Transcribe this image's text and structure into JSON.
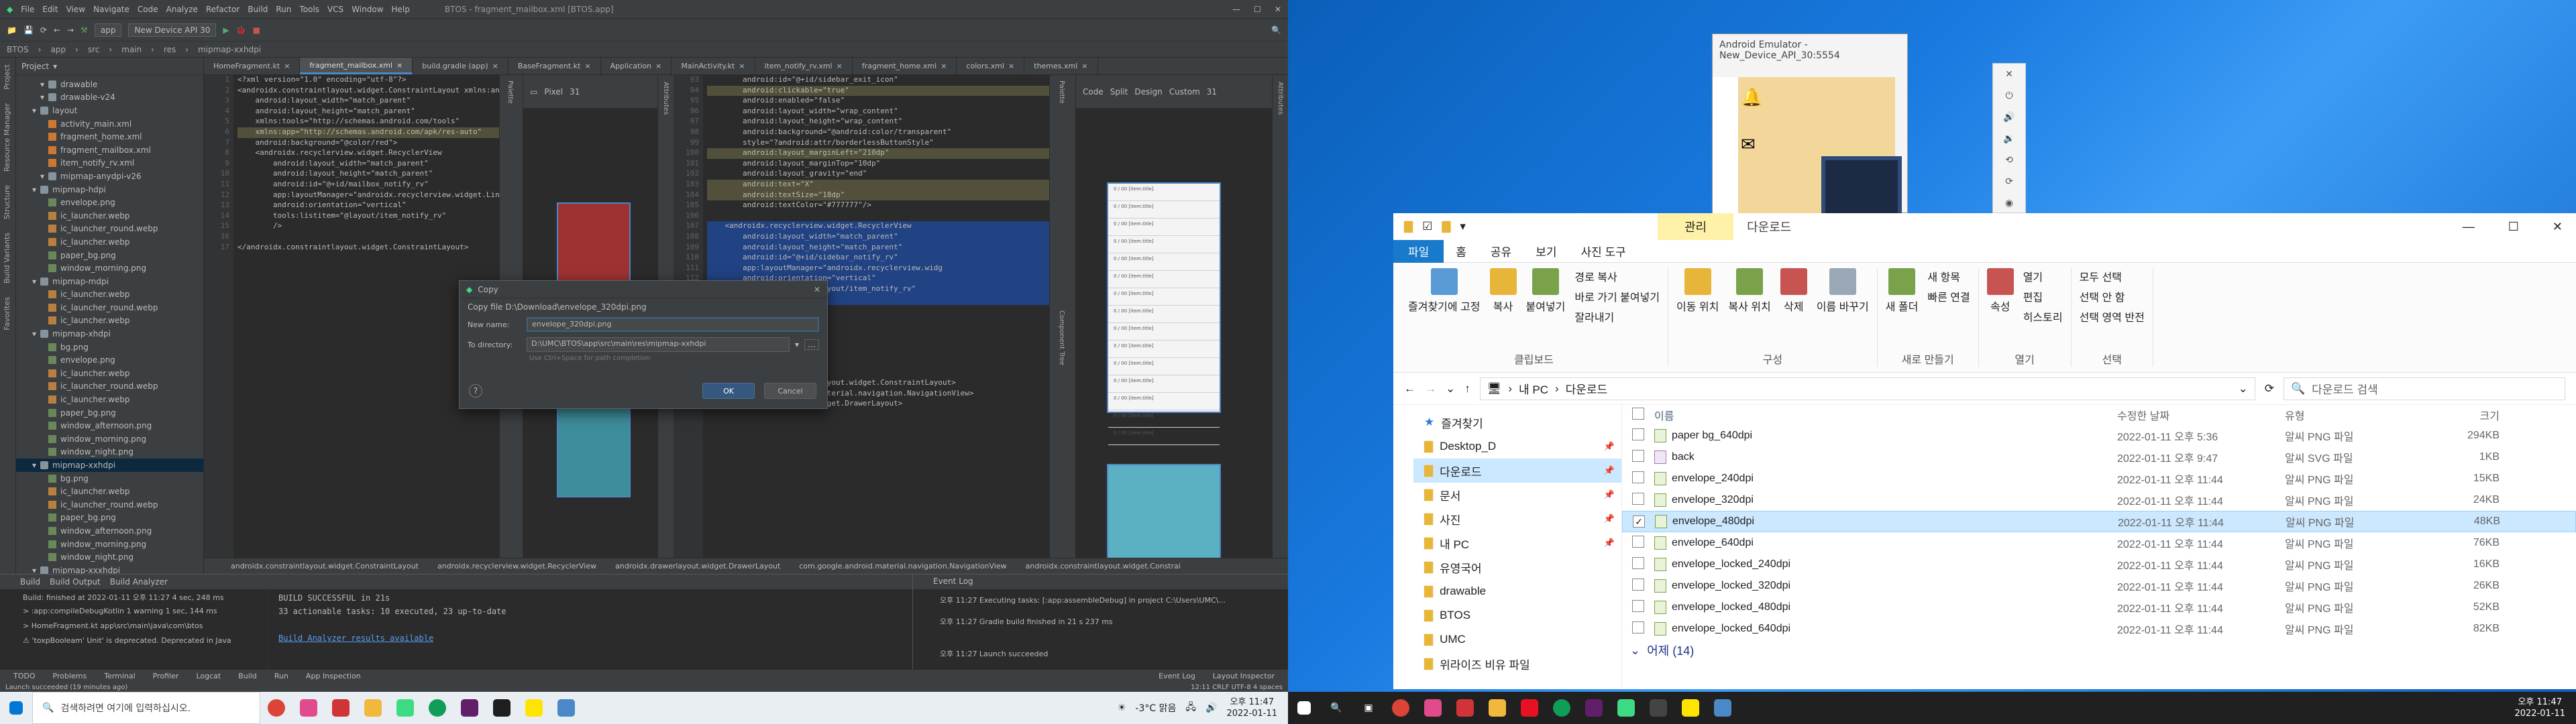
{
  "studio": {
    "menu": [
      "File",
      "Edit",
      "View",
      "Navigate",
      "Code",
      "Analyze",
      "Refactor",
      "Build",
      "Run",
      "Tools",
      "VCS",
      "Window",
      "Help"
    ],
    "window_title": "BTOS - fragment_mailbox.xml [BTOS.app]",
    "toolbar": {
      "module": "app",
      "device": "New Device API 30"
    },
    "breadcrumbs": [
      "BTOS",
      "app",
      "src",
      "main",
      "res",
      "mipmap-xxhdpi"
    ],
    "left_strip": [
      "Project",
      "Resource Manager",
      "Structure",
      "Build Variants",
      "Favorites"
    ],
    "project_header": "Project",
    "tree": [
      {
        "t": "drawable",
        "k": "folder",
        "d": 3
      },
      {
        "t": "drawable-v24",
        "k": "folder",
        "d": 3
      },
      {
        "t": "layout",
        "k": "folder",
        "d": 2
      },
      {
        "t": "activity_main.xml",
        "k": "xml",
        "d": 4
      },
      {
        "t": "fragment_home.xml",
        "k": "xml",
        "d": 4
      },
      {
        "t": "fragment_mailbox.xml",
        "k": "xml",
        "d": 4
      },
      {
        "t": "item_notify_rv.xml",
        "k": "xml",
        "d": 4
      },
      {
        "t": "mipmap-anydpi-v26",
        "k": "folder",
        "d": 3
      },
      {
        "t": "mipmap-hdpi",
        "k": "folder",
        "d": 2
      },
      {
        "t": "envelope.png",
        "k": "png",
        "d": 4
      },
      {
        "t": "ic_launcher.webp",
        "k": "webp",
        "d": 4
      },
      {
        "t": "ic_launcher_round.webp",
        "k": "webp",
        "d": 4
      },
      {
        "t": "ic_launcher.webp",
        "k": "webp",
        "d": 4
      },
      {
        "t": "paper_bg.png",
        "k": "png",
        "d": 4
      },
      {
        "t": "window_morning.png",
        "k": "png",
        "d": 4
      },
      {
        "t": "mipmap-mdpi",
        "k": "folder",
        "d": 2
      },
      {
        "t": "ic_launcher.webp",
        "k": "webp",
        "d": 4
      },
      {
        "t": "ic_launcher_round.webp",
        "k": "webp",
        "d": 4
      },
      {
        "t": "ic_launcher.webp",
        "k": "webp",
        "d": 4
      },
      {
        "t": "mipmap-xhdpi",
        "k": "folder",
        "d": 2
      },
      {
        "t": "bg.png",
        "k": "png",
        "d": 4
      },
      {
        "t": "envelope.png",
        "k": "png",
        "d": 4
      },
      {
        "t": "ic_launcher.webp",
        "k": "webp",
        "d": 4
      },
      {
        "t": "ic_launcher_round.webp",
        "k": "webp",
        "d": 4
      },
      {
        "t": "ic_launcher.webp",
        "k": "webp",
        "d": 4
      },
      {
        "t": "paper_bg.png",
        "k": "png",
        "d": 4
      },
      {
        "t": "window_afternoon.png",
        "k": "png",
        "d": 4
      },
      {
        "t": "window_morning.png",
        "k": "png",
        "d": 4
      },
      {
        "t": "window_night.png",
        "k": "png",
        "d": 4
      },
      {
        "t": "mipmap-xxhdpi",
        "k": "folder",
        "d": 2,
        "sel": true
      },
      {
        "t": "bg.png",
        "k": "png",
        "d": 4
      },
      {
        "t": "ic_launcher.webp",
        "k": "webp",
        "d": 4
      },
      {
        "t": "ic_launcher_round.webp",
        "k": "webp",
        "d": 4
      },
      {
        "t": "paper_bg.png",
        "k": "png",
        "d": 4
      },
      {
        "t": "window_afternoon.png",
        "k": "png",
        "d": 4
      },
      {
        "t": "window_morning.png",
        "k": "png",
        "d": 4
      },
      {
        "t": "window_night.png",
        "k": "png",
        "d": 4
      },
      {
        "t": "mipmap-xxxhdpi",
        "k": "folder",
        "d": 2
      }
    ],
    "tabs": [
      {
        "t": "HomeFragment.kt",
        "a": false
      },
      {
        "t": "fragment_mailbox.xml",
        "a": true
      },
      {
        "t": "build.gradle (app)",
        "a": false
      },
      {
        "t": "BaseFragment.kt",
        "a": false
      },
      {
        "t": "Application",
        "a": false
      },
      {
        "t": "MainActivity.kt",
        "a": false
      },
      {
        "t": "item_notify_rv.xml",
        "a": false
      },
      {
        "t": "fragment_home.xml",
        "a": false
      },
      {
        "t": "colors.xml",
        "a": false
      },
      {
        "t": "themes.xml",
        "a": false
      }
    ],
    "code_left": [
      {
        "t": "<?xml version=\"1.0\" encoding=\"utf-8\"?>"
      },
      {
        "t": "<androidx.constraintlayout.widget.ConstraintLayout xmlns:android=\"http://sch"
      },
      {
        "t": "    android:layout_width=\"match_parent\""
      },
      {
        "t": "    android:layout_height=\"match_parent\""
      },
      {
        "t": "    xmlns:tools=\"http://schemas.android.com/tools\""
      },
      {
        "t": "    xmlns:app=\"http://schemas.android.com/apk/res-auto\"",
        "y": true
      },
      {
        "t": "    android:background=\"@color/red\">"
      },
      {
        "t": "    <androidx.recyclerview.widget.RecyclerView"
      },
      {
        "t": "        android:layout_width=\"match_parent\""
      },
      {
        "t": "        android:layout_height=\"match_parent\""
      },
      {
        "t": "        android:id=\"@+id/mailbox_notify_rv\""
      },
      {
        "t": "        app:layoutManager=\"androidx.recyclerview.widget.LinearLayoutMana"
      },
      {
        "t": "        android:orientation=\"vertical\""
      },
      {
        "t": "        tools:listitem=\"@layout/item_notify_rv\""
      },
      {
        "t": "        />"
      },
      {
        "t": ""
      },
      {
        "t": "</androidx.constraintlayout.widget.ConstraintLayout>"
      }
    ],
    "code_right": [
      {
        "t": "        android:id=\"@+id/sidebar_exit_icon\""
      },
      {
        "t": "        android:clickable=\"true\"",
        "y": true
      },
      {
        "t": "        android:enabled=\"false\""
      },
      {
        "t": "        android:layout_width=\"wrap_content\""
      },
      {
        "t": "        android:layout_height=\"wrap_content\""
      },
      {
        "t": "        android:background=\"@android:color/transparent\""
      },
      {
        "t": "        style=\"?android:attr/borderlessButtonStyle\""
      },
      {
        "t": "        android:layout_marginLeft=\"210dp\"",
        "y": true
      },
      {
        "t": "        android:layout_marginTop=\"10dp\""
      },
      {
        "t": "        android:layout_gravity=\"end\""
      },
      {
        "t": "        android:text=\"X\"",
        "y": true
      },
      {
        "t": "        android:textSize=\"18dp\"",
        "y": true
      },
      {
        "t": "        android:textColor=\"#777777\"/>"
      },
      {
        "t": ""
      },
      {
        "t": "    <androidx.recyclerview.widget.RecyclerView",
        "h": true
      },
      {
        "t": "        android:layout_width=\"match_parent\"",
        "h": true
      },
      {
        "t": "        android:layout_height=\"match_parent\"",
        "h": true
      },
      {
        "t": "        android:id=\"@+id/sidebar_notify_rv\"",
        "h": true
      },
      {
        "t": "        app:layoutManager=\"androidx.recyclerview.widg",
        "h": true
      },
      {
        "t": "        android:orientation=\"vertical\"",
        "h": true
      },
      {
        "t": "        tools:listitem=\"@layout/item_notify_rv\"",
        "h": true
      },
      {
        "t": "        />",
        "h": true
      },
      {
        "t": ""
      },
      {
        "t": ""
      },
      {
        "t": ""
      },
      {
        "t": ""
      },
      {
        "t": ""
      },
      {
        "t": ""
      },
      {
        "t": "        </LinearLayout>"
      },
      {
        "t": "    </androidx.constraintlayout.widget.ConstraintLayout>"
      },
      {
        "t": "    </com.google.android.material.navigation.NavigationView>"
      },
      {
        "t": "</androidx.drawerlayout.widget.DrawerLayout>"
      }
    ],
    "design_toolbar_l": [
      "Pixel",
      "31"
    ],
    "design_toolbar_r": [
      "Custom",
      "31"
    ],
    "view_modes": [
      "Code",
      "Split",
      "Design"
    ],
    "attributes_label": "Attributes",
    "palette_label": "Palette",
    "component_tree": "Component Tree",
    "white_list_items": [
      "0 / 00 [item.title]",
      "0 / 00 [item.title]",
      "0 / 00 [item.title]",
      "0 / 00 [item.title]",
      "0 / 00 [item.title]",
      "0 / 00 [item.title]",
      "0 / 00 [item.title]",
      "0 / 00 [item.title]",
      "0 / 00 [item.title]",
      "0 / 00 [item.title]",
      "0 / 00 [item.title]",
      "0 / 00 [item.title]",
      "0 / 00 [item.title]",
      "0 / 00 [item.title]",
      "0 / 00 [item.title]"
    ],
    "bottom_crumbs": [
      "androidx.constraintlayout.widget.ConstraintLayout",
      "androidx.recyclerview.widget.RecyclerView",
      "androidx.drawerlayout.widget.DrawerLayout",
      "com.google.android.material.navigation.NavigationView",
      "androidx.constraintlayout.widget.Constrai"
    ],
    "build": {
      "tabs": [
        "Build",
        "Build Output",
        "Build Analyzer"
      ],
      "tree": [
        "Build: finished at 2022-01-11 오후 11:27 4 sec, 248 ms",
        "> :app:compileDebugKotlin  1 warning   1 sec, 144 ms",
        "> HomeFragment.kt  app\\src\\main\\java\\com\\btos",
        "⚠ 'toxpBooleam' Unit' is deprecated. Deprecated in Java"
      ],
      "output": [
        "BUILD SUCCESSFUL in 21s",
        "33 actionable tasks: 10 executed, 23 up-to-date",
        "",
        "Build Analyzer results available"
      ],
      "event_log_title": "Event Log",
      "events": [
        "오후 11:27  Executing tasks: [:app:assembleDebug] in project C:\\Users\\UMC\\...",
        "오후 11:27  Gradle build finished in 21 s 237 ms",
        "",
        "오후 11:27  Launch succeeded"
      ]
    },
    "bottom_tools": [
      "TODO",
      "Problems",
      "Terminal",
      "Profiler",
      "Logcat",
      "Build",
      "Run",
      "App Inspection"
    ],
    "bottom_right_tools": [
      "Event Log",
      "Layout Inspector"
    ],
    "status": "Launch succeeded (19 minutes ago)",
    "status_right": "12:11  CRLF  UTF-8  4 spaces"
  },
  "copy_dialog": {
    "title": "Copy",
    "heading": "Copy file D:\\Download\\envelope_320dpi.png",
    "name_label": "New name:",
    "name_value": "envelope_320dpi.png",
    "dir_label": "To directory:",
    "dir_value": "D:\\UMC\\BTOS\\app\\src\\main\\res\\mipmap-xxhdpi",
    "hint": "Use Ctrl+Space for path completion",
    "ok": "OK",
    "cancel": "Cancel",
    "help": "?"
  },
  "emulator": {
    "title": "Android Emulator - New_Device_API_30:5554"
  },
  "explorer": {
    "manage_tab": "관리",
    "title": "다운로드",
    "ribbon_tabs": [
      "파일",
      "홈",
      "공유",
      "보기",
      "사진 도구"
    ],
    "groups": [
      {
        "name": "클립보드",
        "big": [
          "즐겨찾기에 고정",
          "복사",
          "붙여넣기"
        ],
        "small": [
          "경로 복사",
          "바로 가기 붙여넣기",
          "잘라내기"
        ]
      },
      {
        "name": "구성",
        "big": [
          "이동 위치",
          "복사 위치",
          "삭제",
          "이름 바꾸기"
        ],
        "small": []
      },
      {
        "name": "새로 만들기",
        "big": [
          "새 폴더"
        ],
        "small": [
          "새 항목",
          "빠른 연결"
        ]
      },
      {
        "name": "열기",
        "big": [
          "속성"
        ],
        "small": [
          "열기",
          "편집",
          "히스토리"
        ]
      },
      {
        "name": "선택",
        "big": [],
        "small": [
          "모두 선택",
          "선택 안 함",
          "선택 영역 반전"
        ]
      }
    ],
    "address": [
      "내 PC",
      "다운로드"
    ],
    "search_placeholder": "다운로드 검색",
    "nav": [
      {
        "t": "즐겨찾기",
        "pin": false
      },
      {
        "t": "Desktop_D",
        "pin": true
      },
      {
        "t": "다운로드",
        "pin": true,
        "sel": true
      },
      {
        "t": "문서",
        "pin": true
      },
      {
        "t": "사진",
        "pin": true
      },
      {
        "t": "내 PC",
        "pin": true
      },
      {
        "t": "유영국어",
        "pin": false
      },
      {
        "t": "drawable",
        "pin": false
      },
      {
        "t": "BTOS",
        "pin": false
      },
      {
        "t": "UMC",
        "pin": false
      },
      {
        "t": "위라이즈 비유 파일",
        "pin": false
      }
    ],
    "columns": [
      "이름",
      "수정한 날짜",
      "유형",
      "크기"
    ],
    "files": [
      {
        "n": "paper bg_640dpi",
        "d": "2022-01-11 오후 5:36",
        "t": "알씨 PNG 파일",
        "s": "294KB"
      },
      {
        "n": "back",
        "d": "2022-01-11 오후 9:47",
        "t": "알씨 SVG 파일",
        "s": "1KB",
        "svg": true
      },
      {
        "n": "envelope_240dpi",
        "d": "2022-01-11 오후 11:44",
        "t": "알씨 PNG 파일",
        "s": "15KB"
      },
      {
        "n": "envelope_320dpi",
        "d": "2022-01-11 오후 11:44",
        "t": "알씨 PNG 파일",
        "s": "24KB"
      },
      {
        "n": "envelope_480dpi",
        "d": "2022-01-11 오후 11:44",
        "t": "알씨 PNG 파일",
        "s": "48KB",
        "sel": true
      },
      {
        "n": "envelope_640dpi",
        "d": "2022-01-11 오후 11:44",
        "t": "알씨 PNG 파일",
        "s": "76KB"
      },
      {
        "n": "envelope_locked_240dpi",
        "d": "2022-01-11 오후 11:44",
        "t": "알씨 PNG 파일",
        "s": "16KB"
      },
      {
        "n": "envelope_locked_320dpi",
        "d": "2022-01-11 오후 11:44",
        "t": "알씨 PNG 파일",
        "s": "26KB"
      },
      {
        "n": "envelope_locked_480dpi",
        "d": "2022-01-11 오후 11:44",
        "t": "알씨 PNG 파일",
        "s": "52KB"
      },
      {
        "n": "envelope_locked_640dpi",
        "d": "2022-01-11 오후 11:44",
        "t": "알씨 PNG 파일",
        "s": "82KB"
      }
    ],
    "group_yesterday": "어제 (14)"
  },
  "taskbar_left": {
    "search_placeholder": "검색하려면 여기에 입력하십시오.",
    "weather": "-3°C 맑음",
    "time": "오후 11:47",
    "date": "2022-01-11"
  },
  "taskbar_right": {
    "time": "오후 11:47",
    "date": "2022-01-11"
  }
}
